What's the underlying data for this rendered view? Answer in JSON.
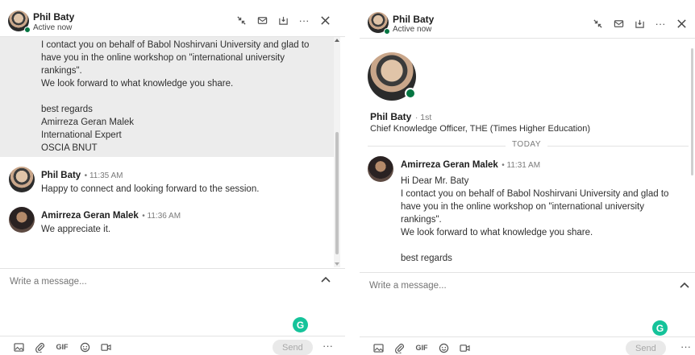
{
  "left": {
    "header": {
      "name": "Phil Baty",
      "status": "Active now"
    },
    "thread": {
      "first_message_lines": [
        "I contact you on behalf of Babol Noshirvani University and glad to",
        "have you in the online workshop on \"international university",
        "rankings\".",
        "We look forward to what knowledge you share.",
        "",
        "best regards",
        "Amirreza Geran Malek",
        "International Expert",
        "OSCIA BNUT"
      ],
      "messages": [
        {
          "sender": "Phil Baty",
          "time": "• 11:35 AM",
          "text": "Happy to connect and looking forward to the session."
        },
        {
          "sender": "Amirreza Geran Malek",
          "time": "• 11:36 AM",
          "text": "We appreciate it."
        }
      ]
    },
    "compose": {
      "placeholder": "Write a message..."
    },
    "toolbar": {
      "gif_label": "GIF",
      "send_label": "Send",
      "more_label": "···"
    }
  },
  "right": {
    "header": {
      "name": "Phil Baty",
      "status": "Active now"
    },
    "profile": {
      "name": "Phil Baty",
      "degree": "· 1st",
      "headline": "Chief Knowledge Officer, THE (Times Higher Education)"
    },
    "divider_label": "TODAY",
    "message": {
      "sender": "Amirreza Geran Malek",
      "time": "• 11:31 AM",
      "lines": [
        "Hi Dear Mr. Baty",
        "I contact you on behalf of Babol Noshirvani University and glad to",
        "have you in the online workshop on \"international university",
        "rankings\".",
        "We look forward to what knowledge you share.",
        "",
        "best regards"
      ]
    },
    "compose": {
      "placeholder": "Write a message..."
    },
    "toolbar": {
      "gif_label": "GIF",
      "send_label": "Send",
      "more_label": "···"
    }
  },
  "grammarly_icon": "G",
  "colors": {
    "online": "#057642",
    "grammarly": "#15c39a",
    "selected_bg": "#ececec"
  }
}
